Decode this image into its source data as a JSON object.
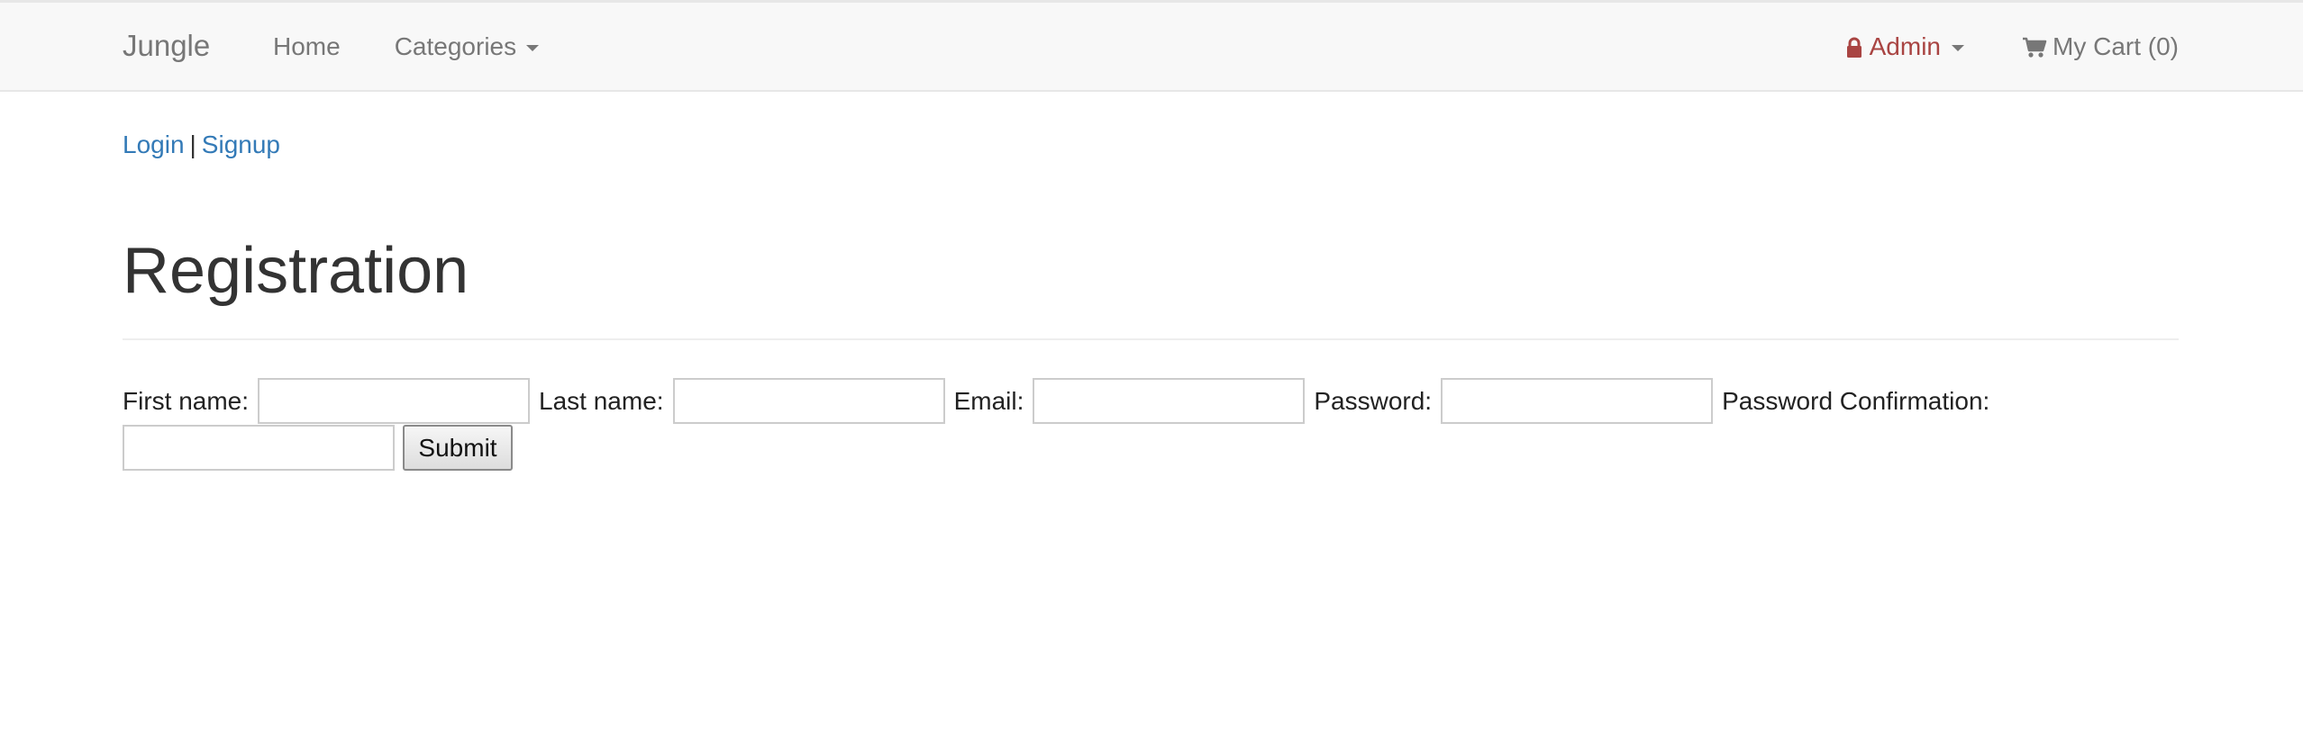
{
  "navbar": {
    "brand": "Jungle",
    "links": [
      {
        "label": "Home"
      },
      {
        "label": "Categories"
      }
    ],
    "admin_label": "Admin",
    "cart_label": "My Cart (0)",
    "icons": {
      "admin": "lock-icon",
      "cart": "shopping-cart-icon",
      "dropdown": "caret-down-icon"
    },
    "colors": {
      "admin": "#a94442",
      "nav_text": "#777777",
      "background": "#f8f8f8"
    }
  },
  "auth": {
    "login": "Login",
    "separator": "|",
    "signup": "Signup",
    "link_color": "#337ab7"
  },
  "page": {
    "title": "Registration"
  },
  "form": {
    "first_name_label": "First name:",
    "first_name_value": "",
    "last_name_label": "Last name:",
    "last_name_value": "",
    "email_label": "Email:",
    "email_value": "",
    "password_label": "Password:",
    "password_value": "",
    "password_confirmation_label": "Password Confirmation:",
    "password_confirmation_value": "",
    "submit_label": "Submit"
  }
}
